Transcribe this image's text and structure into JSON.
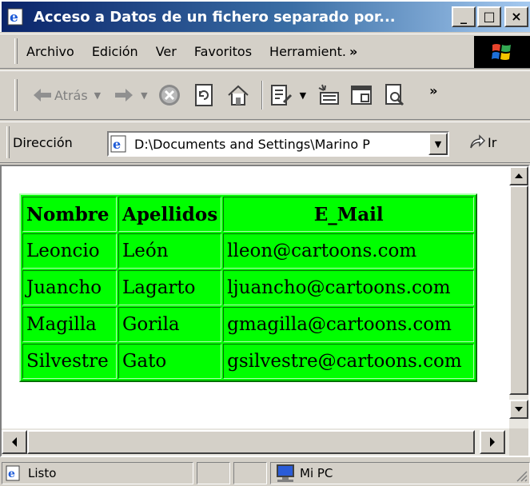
{
  "window": {
    "title": "Acceso a Datos de un fichero separado por...",
    "buttons": {
      "minimize": "_",
      "maximize": "□",
      "close": "×"
    }
  },
  "menu": {
    "items": [
      "Archivo",
      "Edición",
      "Ver",
      "Favoritos",
      "Herramient."
    ],
    "overflow": "»"
  },
  "toolbar": {
    "back_label": "Atrás",
    "overflow": "»"
  },
  "address": {
    "label": "Dirección",
    "value": "D:\\Documents and Settings\\Marino P",
    "go_label": "Ir"
  },
  "table": {
    "headers": [
      "Nombre",
      "Apellidos",
      "E_Mail"
    ],
    "rows": [
      [
        "Leoncio",
        "León",
        "lleon@cartoons.com"
      ],
      [
        "Juancho",
        "Lagarto",
        "ljuancho@cartoons.com"
      ],
      [
        "Magilla",
        "Gorila",
        "gmagilla@cartoons.com"
      ],
      [
        "Silvestre",
        "Gato",
        "gsilvestre@cartoons.com"
      ]
    ]
  },
  "status": {
    "text": "Listo",
    "zone": "Mi PC"
  },
  "colors": {
    "table_bg": "#00ff00",
    "titlebar_start": "#0a246a",
    "titlebar_end": "#a6caf0"
  }
}
